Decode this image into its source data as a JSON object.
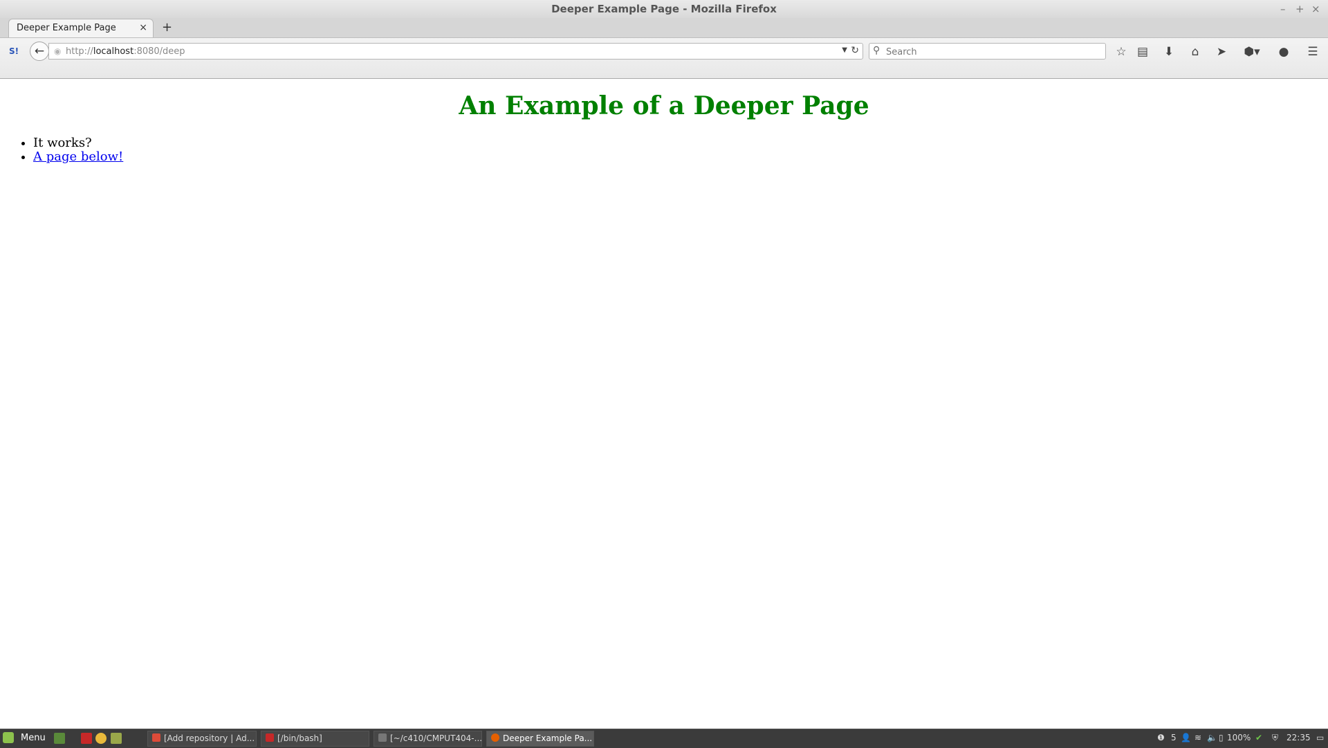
{
  "window": {
    "title": "Deeper Example Page - Mozilla Firefox",
    "minimize": "–",
    "maximize": "+",
    "close": "×"
  },
  "tabs": [
    {
      "label": "Deeper Example Page",
      "close": "×"
    }
  ],
  "new_tab": "+",
  "navbar": {
    "back": "←",
    "url_prefix": "http://",
    "url_host": "localhost",
    "url_rest": ":8080/deep",
    "search_placeholder": "Search",
    "icons": [
      "bookmark-star-icon",
      "reading-list-icon",
      "downloads-icon",
      "home-icon",
      "send-icon",
      "adblock-icon",
      "chat-icon",
      "hamburger-menu-icon"
    ]
  },
  "page": {
    "heading": "An Example of a Deeper Page",
    "items": [
      {
        "text": "It works?",
        "link": false
      },
      {
        "text": "A page below!",
        "link": true
      }
    ]
  },
  "taskbar": {
    "menu_label": "Menu",
    "tasks": [
      {
        "label": "[Add repository | Ad...",
        "color": "#dd4b39"
      },
      {
        "label": "[/bin/bash]",
        "color": "#c62828"
      },
      {
        "label": "[~/c410/CMPUT404-...",
        "color": "#777777"
      },
      {
        "label": "Deeper Example Pa...",
        "color": "#e66000",
        "active": true
      }
    ],
    "tray": {
      "notifications": "5",
      "battery": "100%",
      "clock": "22:35"
    }
  },
  "colors": {
    "heading": "#008000",
    "link": "#0000ee"
  }
}
